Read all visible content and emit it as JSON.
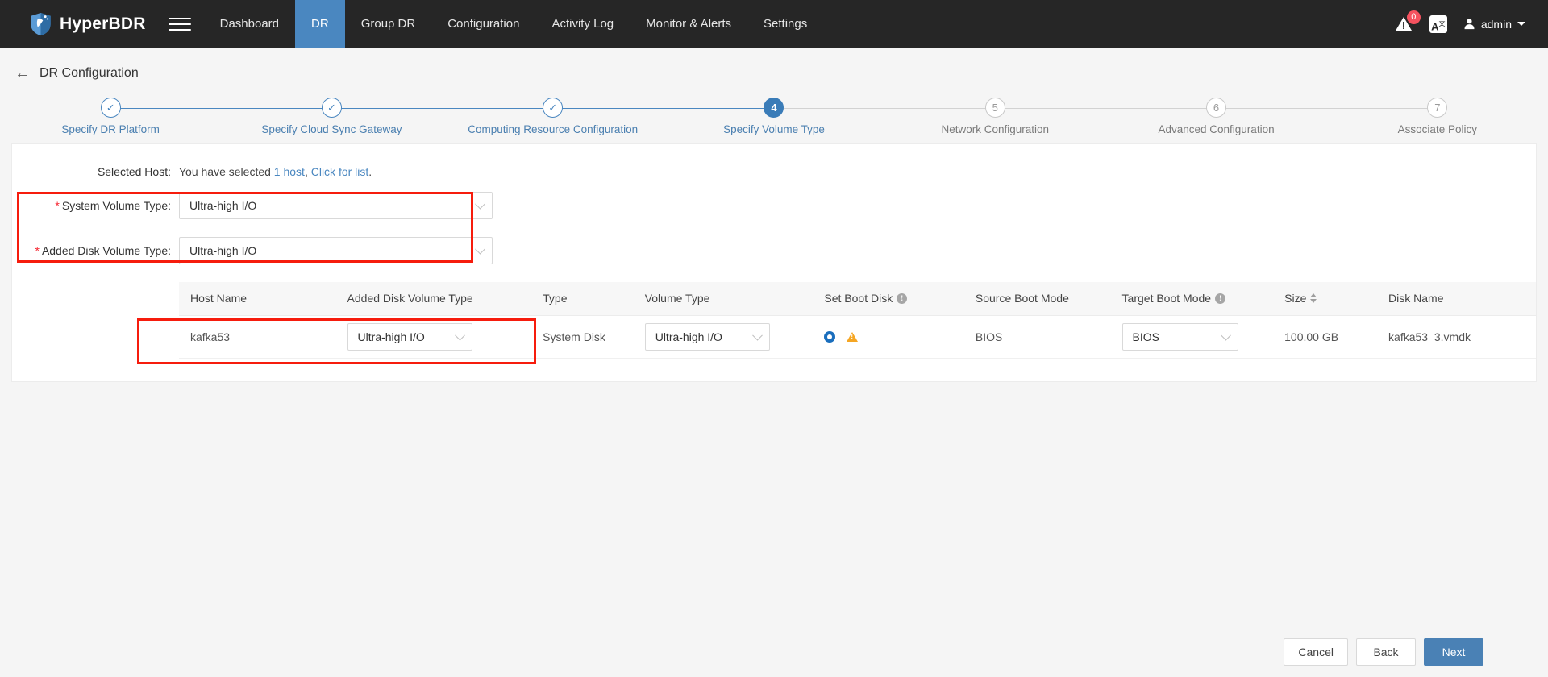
{
  "topnav": {
    "brand": "HyperBDR",
    "menu_icon": "hamburger-icon",
    "items": [
      {
        "label": "Dashboard",
        "active": false
      },
      {
        "label": "DR",
        "active": true
      },
      {
        "label": "Group DR",
        "active": false
      },
      {
        "label": "Configuration",
        "active": false
      },
      {
        "label": "Activity Log",
        "active": false
      },
      {
        "label": "Monitor & Alerts",
        "active": false
      },
      {
        "label": "Settings",
        "active": false
      }
    ],
    "alert_badge": "0",
    "lang_label": "A",
    "lang_sup": "文",
    "user": "admin"
  },
  "page": {
    "back_label": "←",
    "title": "DR Configuration"
  },
  "stepper": {
    "steps": [
      {
        "num": "1",
        "label": "Specify DR Platform",
        "state": "done",
        "glyph": "✓"
      },
      {
        "num": "2",
        "label": "Specify Cloud Sync Gateway",
        "state": "done",
        "glyph": "✓"
      },
      {
        "num": "3",
        "label": "Computing Resource Configuration",
        "state": "done",
        "glyph": "✓"
      },
      {
        "num": "4",
        "label": "Specify Volume Type",
        "state": "active",
        "glyph": "4"
      },
      {
        "num": "5",
        "label": "Network Configuration",
        "state": "todo",
        "glyph": "5"
      },
      {
        "num": "6",
        "label": "Advanced Configuration",
        "state": "todo",
        "glyph": "6"
      },
      {
        "num": "7",
        "label": "Associate Policy",
        "state": "todo",
        "glyph": "7"
      }
    ]
  },
  "selected_host": {
    "label": "Selected Host:",
    "text_prefix": "You have selected ",
    "count": "1 host",
    "separator": ", ",
    "link": "Click for list",
    "suffix": "."
  },
  "form": {
    "system_volume_type": {
      "label": "System Volume Type:",
      "required": "*",
      "value": "Ultra-high I/O"
    },
    "added_disk_volume_type": {
      "label": "Added Disk Volume Type:",
      "required": "*",
      "value": "Ultra-high I/O"
    }
  },
  "table": {
    "headers": [
      {
        "label": "Host Name",
        "info": false,
        "sort": false
      },
      {
        "label": "Added Disk Volume Type",
        "info": false,
        "sort": false
      },
      {
        "label": "Type",
        "info": false,
        "sort": false
      },
      {
        "label": "Volume Type",
        "info": false,
        "sort": false
      },
      {
        "label": "Set Boot Disk",
        "info": true,
        "sort": false
      },
      {
        "label": "Source Boot Mode",
        "info": false,
        "sort": false
      },
      {
        "label": "Target Boot Mode",
        "info": true,
        "sort": false
      },
      {
        "label": "Size",
        "info": false,
        "sort": true
      },
      {
        "label": "Disk Name",
        "info": false,
        "sort": false
      }
    ],
    "rows": [
      {
        "host_name": "kafka53",
        "added_disk_volume_type": "Ultra-high I/O",
        "type": "System Disk",
        "volume_type": "Ultra-high I/O",
        "set_boot_disk": "selected",
        "boot_warning": "warning-triangle-icon",
        "source_boot_mode": "BIOS",
        "target_boot_mode": "BIOS",
        "size": "100.00 GB",
        "disk_name": "kafka53_3.vmdk"
      }
    ]
  },
  "footer": {
    "cancel": "Cancel",
    "back": "Back",
    "next": "Next"
  },
  "colors": {
    "accent": "#4a87c0",
    "primary_button": "#4a81b5",
    "highlight": "#f61c0d",
    "badge": "#f5525f",
    "warning": "#f5a623",
    "nav_bg": "#262626"
  }
}
